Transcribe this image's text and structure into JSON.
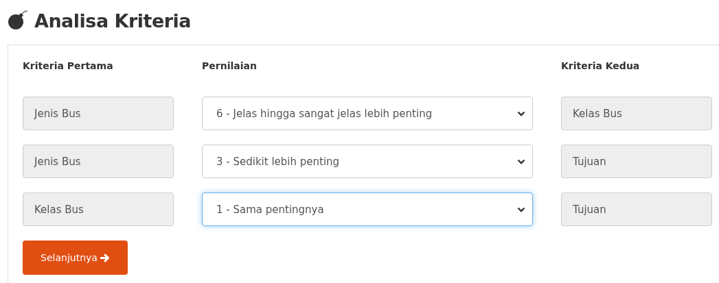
{
  "title": "Analisa Kriteria",
  "columns": [
    "Kriteria Pertama",
    "Pernilaian",
    "Kriteria Kedua"
  ],
  "rows": [
    {
      "first": "Jenis Bus",
      "rating": "6 - Jelas hingga sangat jelas lebih penting",
      "second": "Kelas Bus",
      "focused": false
    },
    {
      "first": "Jenis Bus",
      "rating": "3 - Sedikit lebih penting",
      "second": "Tujuan",
      "focused": false
    },
    {
      "first": "Kelas Bus",
      "rating": "1 - Sama pentingnya",
      "second": "Tujuan",
      "focused": true
    }
  ],
  "next_button": "Selanjutnya"
}
